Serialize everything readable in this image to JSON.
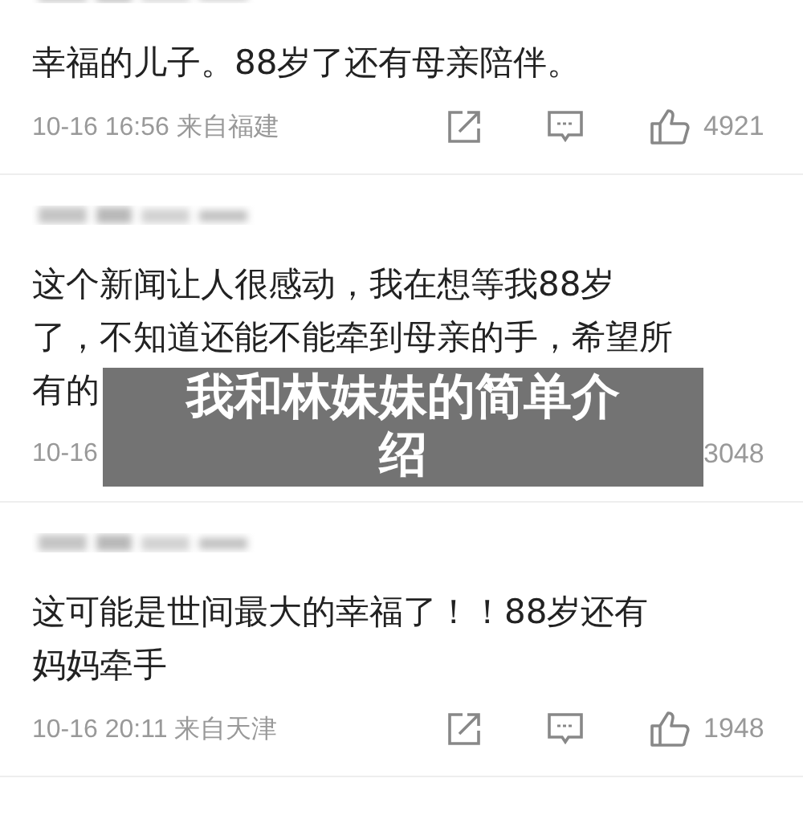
{
  "comments": [
    {
      "lines": [
        "幸福的儿子。88岁了还有母亲陪伴。"
      ],
      "time": "10-16 16:56",
      "location": "来自福建",
      "actions": true,
      "likes": "4921"
    },
    {
      "lines": [
        "这个新闻让人很感动，我在想等我88岁",
        "了，不知道还能不能牵到母亲的手，希望所",
        "有的"
      ],
      "time": "10-16",
      "actions": false,
      "likes": "3048"
    },
    {
      "lines": [
        "这可能是世间最大的幸福了！！88岁还有",
        "妈妈牵手"
      ],
      "time": "10-16 20:11",
      "location": "来自天津",
      "actions": true,
      "likes": "1948"
    }
  ],
  "overlay": {
    "title": "我和林妹妹的简单介绍"
  }
}
